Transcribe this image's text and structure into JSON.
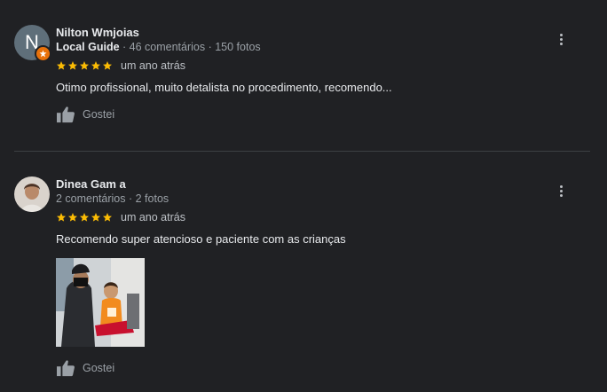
{
  "reviews": [
    {
      "avatar_letter": "N",
      "name": "Nilton Wmjoias",
      "local_guide": "Local Guide",
      "stats": " · 46 comentários · 150 fotos",
      "stars": 5,
      "time": "um ano atrás",
      "text": "Otimo profissional, muito detalista no procedimento, recomendo...",
      "like_label": "Gostei"
    },
    {
      "name": "Dinea Gam a",
      "stats": "2 comentários · 2 fotos",
      "stars": 5,
      "time": "um ano atrás",
      "text": "Recomendo super atencioso e paciente com as crianças",
      "like_label": "Gostei"
    }
  ],
  "colors": {
    "background": "#202124",
    "star": "#fbbc04",
    "badge": "#e8710a"
  }
}
